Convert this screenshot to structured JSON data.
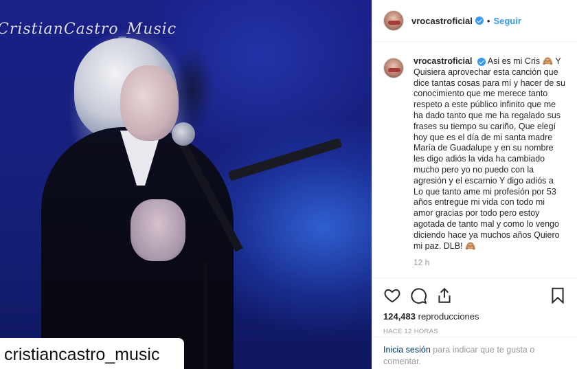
{
  "media": {
    "watermark_text": "CristianCastro_Music",
    "credit_text": "cristiancastro_music"
  },
  "header": {
    "username": "vrocastroficial",
    "separator": "•",
    "follow_label": "Seguir"
  },
  "caption": {
    "username": "vrocastroficial",
    "text": "Asi es mi Cris 🙈 Y Quisiera aprovechar esta canción que dice tantas cosas para mí y hacer de su conocimiento que me merece tanto respeto a este público infinito que me ha dado tanto que me ha regalado sus frases su tiempo su cariño, Que elegí hoy que es el día de mi santa madre María de Guadalupe y en su nombre les digo adiós la vida ha cambiado mucho pero yo no puedo con la agresión y el escarnio Y digo adiós a Lo que tanto ame mi profesión por 53 años entregue mi vida con todo mi amor gracias por todo pero estoy agotada de tanto mal y como lo vengo diciendo hace ya muchos años Quiero mi paz. DLB! 🙈",
    "time_ago": "12 h"
  },
  "actions": {
    "icons": [
      "heart-icon",
      "comment-icon",
      "share-icon",
      "bookmark-icon"
    ],
    "views_count": "124,483",
    "views_label": "reproducciones",
    "timestamp": "HACE 12 HORAS"
  },
  "comment": {
    "login_link": "Inicia sesión",
    "prompt_text": "para indicar que te gusta o comentar."
  },
  "colors": {
    "accent": "#3897f0",
    "text": "#262626",
    "muted": "#999999",
    "link": "#003569"
  }
}
